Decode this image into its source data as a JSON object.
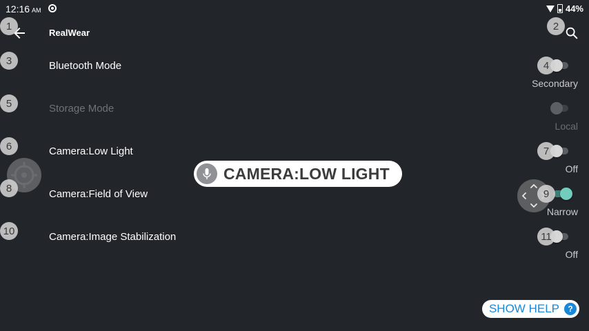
{
  "status_bar": {
    "time": "12:16",
    "ampm": "AM",
    "battery": "44%"
  },
  "app_bar": {
    "title": "RealWear",
    "back_icon": "arrow-left-icon",
    "search_icon": "search-icon"
  },
  "badges": [
    "1",
    "2",
    "3",
    "4",
    "5",
    "6",
    "7",
    "8",
    "9",
    "10",
    "11"
  ],
  "settings": [
    {
      "label": "Bluetooth Mode",
      "value": "Secondary",
      "enabled": true,
      "on": false
    },
    {
      "label": "Storage Mode",
      "value": "Local",
      "enabled": false,
      "on": false
    },
    {
      "label": "Camera:Low Light",
      "value": "Off",
      "enabled": true,
      "on": false
    },
    {
      "label": "Camera:Field of View",
      "value": "Narrow",
      "enabled": true,
      "on": true
    },
    {
      "label": "Camera:Image Stabilization",
      "value": "Off",
      "enabled": true,
      "on": false
    }
  ],
  "voice_command": {
    "text": "CAMERA:LOW LIGHT",
    "icon": "microphone-icon"
  },
  "help_button": {
    "label": "SHOW HELP",
    "icon_text": "?"
  },
  "colors": {
    "background": "#22262b",
    "accent_toggle": "#72cdbf",
    "help_blue": "#1a88d8"
  }
}
